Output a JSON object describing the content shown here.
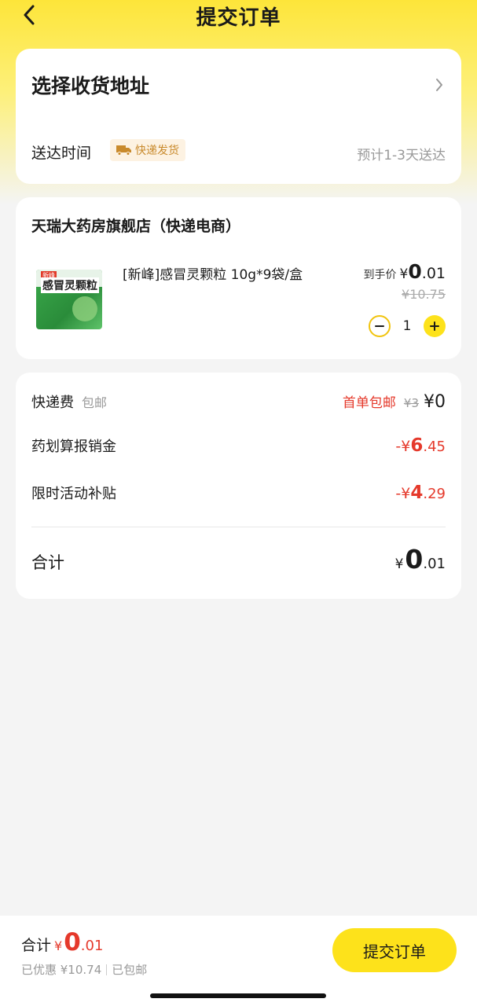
{
  "header": {
    "title": "提交订单"
  },
  "address_card": {
    "select_label": "选择收货地址",
    "delivery_label": "送达时间",
    "delivery_badge": "快递发货",
    "delivery_eta": "预计1-3天送达"
  },
  "product_card": {
    "store_name": "天瑞大药房旗舰店（快递电商）",
    "product": {
      "name": "[新峰]感冒灵颗粒 10g*9袋/盒",
      "image_label": "感冒灵颗粒",
      "image_brand": "新峰",
      "price_label": "到手价",
      "price_currency": "¥",
      "price_int": "0",
      "price_dec": ".01",
      "original_price": "¥10.75",
      "quantity": "1"
    }
  },
  "fee_card": {
    "shipping": {
      "label": "快递费",
      "sublabel": "包邮",
      "promo": "首单包邮",
      "original": "¥3",
      "value": "¥0"
    },
    "insurance": {
      "label": "药划算报销金",
      "sign": "-",
      "currency": "¥",
      "int": "6",
      "dec": ".45"
    },
    "subsidy": {
      "label": "限时活动补贴",
      "sign": "-",
      "currency": "¥",
      "int": "4",
      "dec": ".29"
    },
    "total": {
      "label": "合计",
      "currency": "¥",
      "int": "0",
      "dec": ".01"
    }
  },
  "bottom_bar": {
    "total_label": "合计",
    "currency": "¥",
    "int": "0",
    "dec": ".01",
    "discount_text": "已优惠 ¥10.74",
    "shipping_text": "已包邮",
    "submit_label": "提交订单"
  },
  "colors": {
    "accent_yellow": "#fde21b",
    "price_red": "#e5392b",
    "badge_orange": "#c98a2c"
  }
}
